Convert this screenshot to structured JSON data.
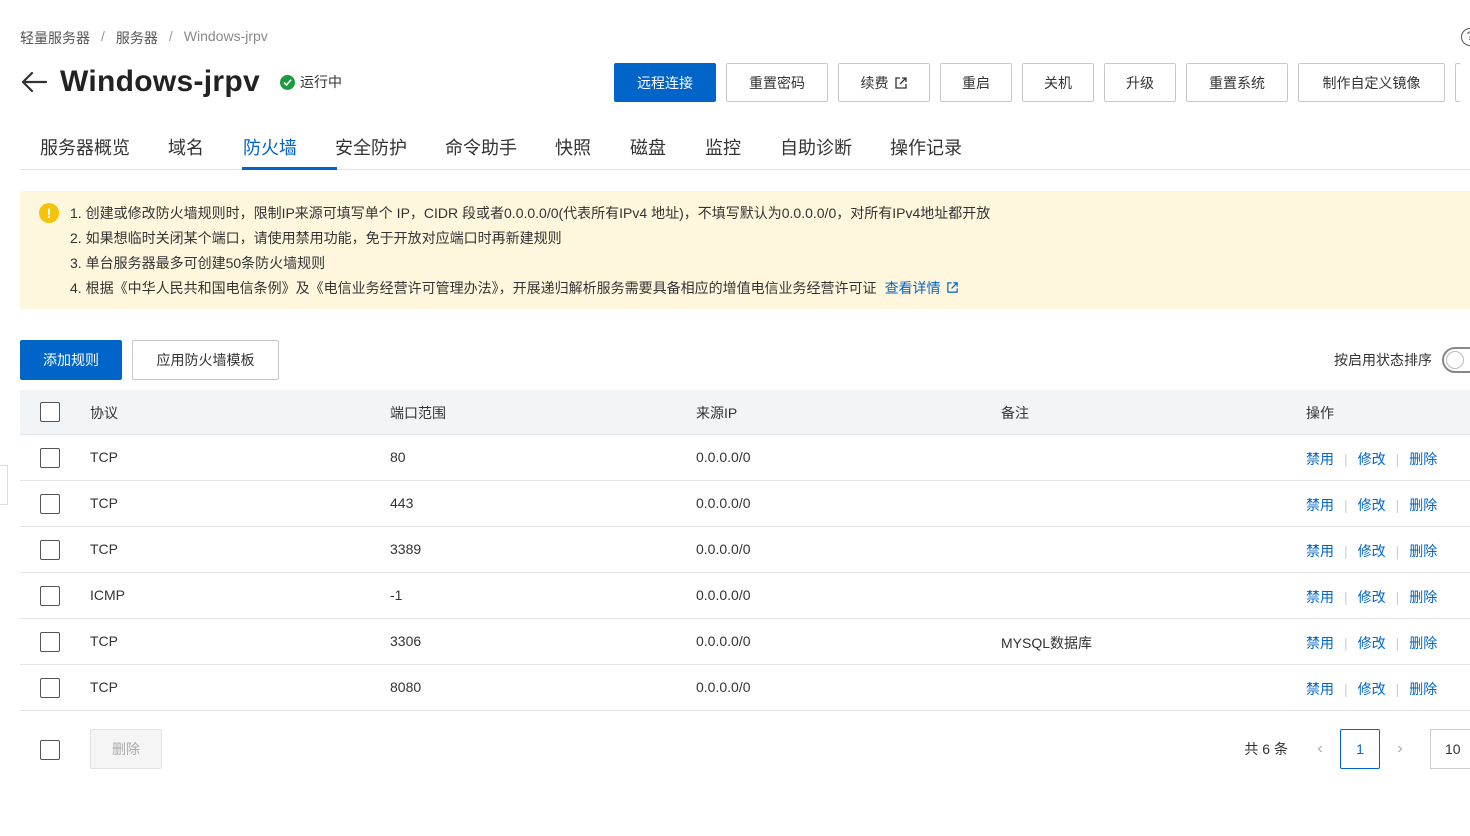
{
  "breadcrumb": [
    "轻量服务器",
    "服务器",
    "Windows-jrpv"
  ],
  "breadcrumb_sep": "/",
  "help_icon_glyph": "?",
  "header": {
    "title": "Windows-jrpv",
    "status": "运行中",
    "status_color": "#1a9c3e"
  },
  "toolbar": {
    "remote_connect": "远程连接",
    "reset_password": "重置密码",
    "renew": "续费",
    "reboot": "重启",
    "shutdown": "关机",
    "upgrade": "升级",
    "reset_system": "重置系统",
    "custom_image": "制作自定义镜像"
  },
  "tabs": [
    "服务器概览",
    "域名",
    "防火墙",
    "安全防护",
    "命令助手",
    "快照",
    "磁盘",
    "监控",
    "自助诊断",
    "操作记录"
  ],
  "active_tab": "防火墙",
  "notice": {
    "lines": [
      "1. 创建或修改防火墙规则时，限制IP来源可填写单个 IP，CIDR 段或者0.0.0.0/0(代表所有IPv4 地址)，不填写默认为0.0.0.0/0，对所有IPv4地址都开放",
      "2. 如果想临时关闭某个端口，请使用禁用功能，免于开放对应端口时再新建规则",
      "3. 单台服务器最多可创建50条防火墙规则",
      "4. 根据《中华人民共和国电信条例》及《电信业务经营许可管理办法》，开展递归解析服务需要具备相应的增值电信业务经营许可证"
    ],
    "link": "查看详情",
    "icon_glyph": "!"
  },
  "actions": {
    "add_rule": "添加规则",
    "apply_template": "应用防火墙模板",
    "sort_label": "按启用状态排序"
  },
  "table": {
    "headers": {
      "protocol": "协议",
      "port": "端口范围",
      "source": "来源IP",
      "note": "备注",
      "ops": "操作"
    },
    "rows": [
      {
        "protocol": "TCP",
        "port": "80",
        "source": "0.0.0.0/0",
        "note": ""
      },
      {
        "protocol": "TCP",
        "port": "443",
        "source": "0.0.0.0/0",
        "note": ""
      },
      {
        "protocol": "TCP",
        "port": "3389",
        "source": "0.0.0.0/0",
        "note": ""
      },
      {
        "protocol": "ICMP",
        "port": "-1",
        "source": "0.0.0.0/0",
        "note": ""
      },
      {
        "protocol": "TCP",
        "port": "3306",
        "source": "0.0.0.0/0",
        "note": "MYSQL数据库"
      },
      {
        "protocol": "TCP",
        "port": "8080",
        "source": "0.0.0.0/0",
        "note": ""
      }
    ],
    "op_labels": {
      "disable": "禁用",
      "edit": "修改",
      "delete": "删除"
    },
    "op_sep": "|"
  },
  "footer": {
    "delete": "删除",
    "total": "共 6 条",
    "page": "1",
    "page_size": "10",
    "prev_glyph": "‹",
    "next_glyph": "›"
  },
  "colors": {
    "primary": "#0064c8",
    "notice_bg": "#fff7dd",
    "warn": "#f5c40a"
  }
}
